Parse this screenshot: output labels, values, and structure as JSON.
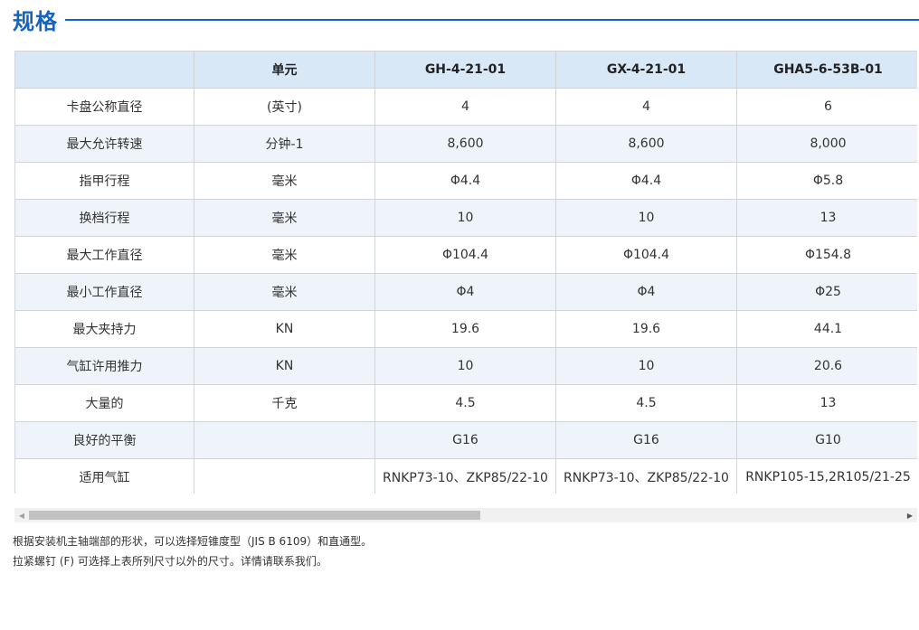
{
  "section": {
    "title": "规格"
  },
  "table": {
    "header": [
      "",
      "单元",
      "GH-4-21-01",
      "GX-4-21-01",
      "GHA5-6-53B-01"
    ],
    "rows": [
      [
        "卡盘公称直径",
        "(英寸)",
        "4",
        "4",
        "6"
      ],
      [
        "最大允许转速",
        "分钟-1",
        "8,600",
        "8,600",
        "8,000"
      ],
      [
        "指甲行程",
        "毫米",
        "Φ4.4",
        "Φ4.4",
        "Φ5.8"
      ],
      [
        "换档行程",
        "毫米",
        "10",
        "10",
        "13"
      ],
      [
        "最大工作直径",
        "毫米",
        "Φ104.4",
        "Φ104.4",
        "Φ154.8"
      ],
      [
        "最小工作直径",
        "毫米",
        "Φ4",
        "Φ4",
        "Φ25"
      ],
      [
        "最大夹持力",
        "KN",
        "19.6",
        "19.6",
        "44.1"
      ],
      [
        "气缸许用推力",
        "KN",
        "10",
        "10",
        "20.6"
      ],
      [
        "大量的",
        "千克",
        "4.5",
        "4.5",
        "13"
      ],
      [
        "良好的平衡",
        "",
        "G16",
        "G16",
        "G10"
      ],
      [
        "适用气缸",
        "",
        "RNKP73-10、ZKP85/22-10",
        "RNKP73-10、ZKP85/22-10",
        "RNKP105-15,2R105/21-25"
      ]
    ]
  },
  "scrollbar": {
    "position": 0.5
  },
  "notes": [
    "根据安装机主轴端部的形状，可以选择短锥度型（JIS B 6109）和直通型。",
    "拉紧螺钉 (F) 可选择上表所列尺寸以外的尺寸。详情请联系我们。"
  ],
  "colors": {
    "accent": "#1565c0",
    "header_bg": "#d9e8f7",
    "stripe_bg": "#eef4f9",
    "border": "#d0d5da"
  }
}
